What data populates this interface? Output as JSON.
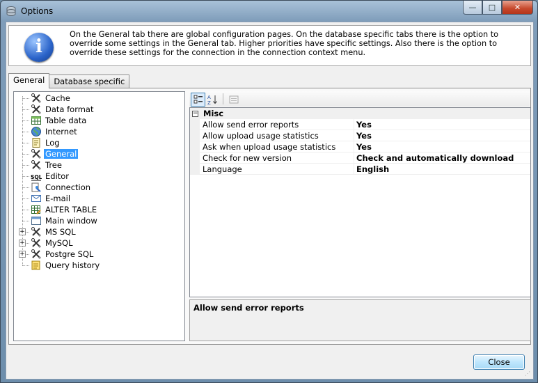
{
  "window": {
    "title": "Options"
  },
  "info": {
    "text": "On the General tab there are global configuration pages. On the database specific tabs there is the option to override some settings in the General tab. Higher priorities have specific settings. Also there is the option to override these settings for the connection in the connection context menu."
  },
  "tabs": [
    {
      "label": "General",
      "active": true
    },
    {
      "label": "Database specific",
      "active": false
    }
  ],
  "tree": {
    "items": [
      {
        "label": "Cache",
        "icon": "tools-icon"
      },
      {
        "label": "Data format",
        "icon": "tools-icon"
      },
      {
        "label": "Table data",
        "icon": "table-icon"
      },
      {
        "label": "Internet",
        "icon": "globe-icon"
      },
      {
        "label": "Log",
        "icon": "log-icon"
      },
      {
        "label": "General",
        "icon": "tools-icon",
        "selected": true
      },
      {
        "label": "Tree",
        "icon": "tools-icon"
      },
      {
        "label": "Editor",
        "icon": "sql-icon"
      },
      {
        "label": "Connection",
        "icon": "connection-icon"
      },
      {
        "label": "E-mail",
        "icon": "envelope-icon"
      },
      {
        "label": "ALTER TABLE",
        "icon": "table-edit-icon"
      },
      {
        "label": "Main window",
        "icon": "window-icon"
      },
      {
        "label": "MS SQL",
        "icon": "tools-icon",
        "expandable": true
      },
      {
        "label": "MySQL",
        "icon": "tools-icon",
        "expandable": true
      },
      {
        "label": "Postgre SQL",
        "icon": "tools-icon",
        "expandable": true
      },
      {
        "label": "Query history",
        "icon": "history-icon"
      }
    ]
  },
  "toolbar": {
    "buttons": [
      {
        "name": "categorized-icon"
      },
      {
        "name": "sort-az-icon"
      },
      {
        "name": "property-pages-icon"
      }
    ]
  },
  "grid": {
    "category": "Misc",
    "rows": [
      {
        "name": "Allow send error reports",
        "value": "Yes"
      },
      {
        "name": "Allow upload usage statistics",
        "value": "Yes"
      },
      {
        "name": "Ask when upload usage statistics",
        "value": "Yes"
      },
      {
        "name": "Check for new version",
        "value": "Check and automatically download"
      },
      {
        "name": "Language",
        "value": "English"
      }
    ]
  },
  "help": {
    "title": "Allow send error reports"
  },
  "footer": {
    "close_label": "Close"
  }
}
